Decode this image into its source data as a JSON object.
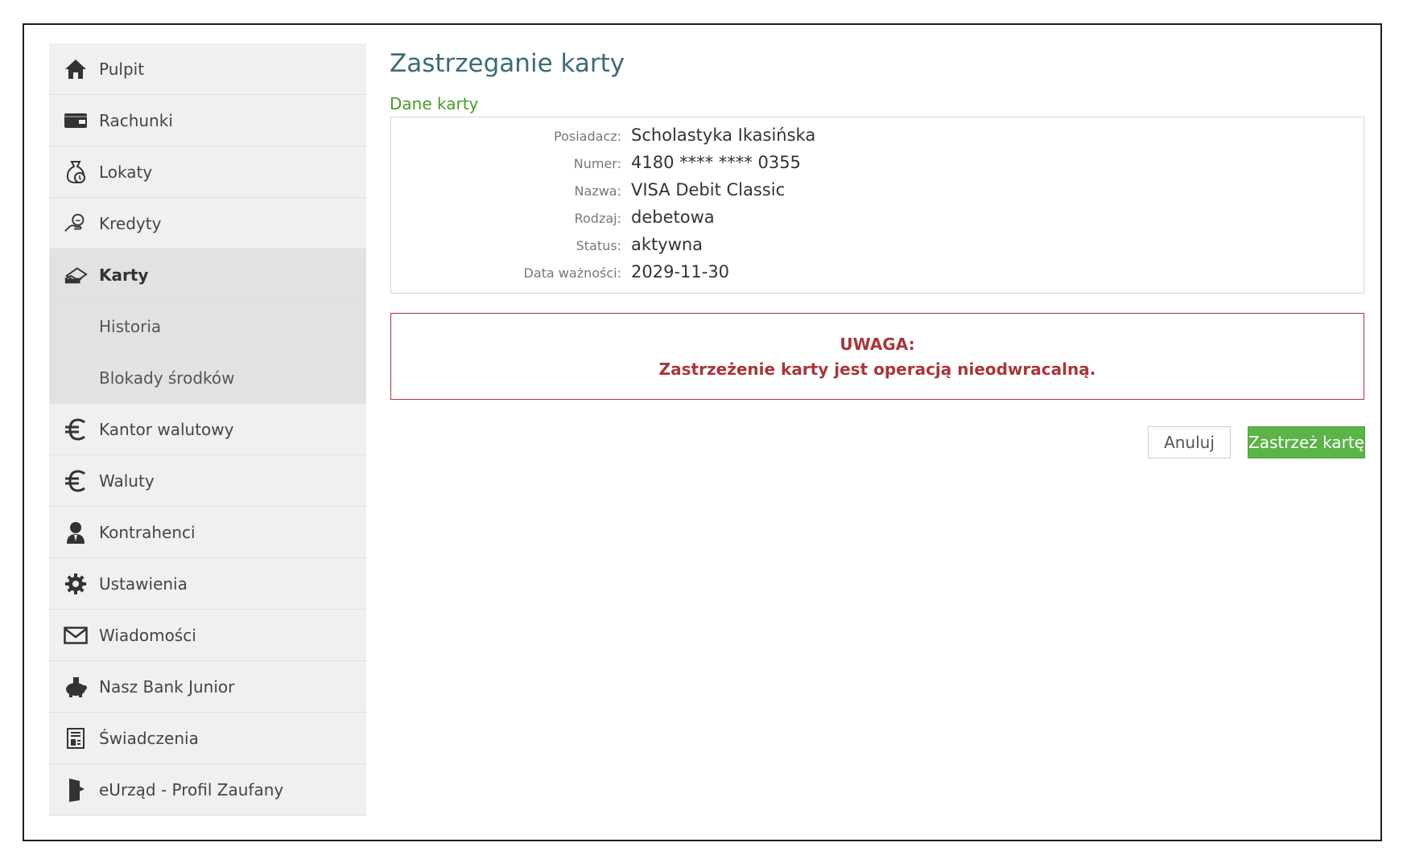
{
  "sidebar": {
    "items": [
      {
        "label": "Pulpit",
        "icon": "home-icon"
      },
      {
        "label": "Rachunki",
        "icon": "wallet-icon"
      },
      {
        "label": "Lokaty",
        "icon": "moneybag-icon"
      },
      {
        "label": "Kredyty",
        "icon": "hand-coin-icon"
      },
      {
        "label": "Karty",
        "icon": "hand-card-icon"
      },
      {
        "label": "Kantor walutowy",
        "icon": "euro-icon"
      },
      {
        "label": "Waluty",
        "icon": "euro-icon"
      },
      {
        "label": "Kontrahenci",
        "icon": "person-icon"
      },
      {
        "label": "Ustawienia",
        "icon": "gear-icon"
      },
      {
        "label": "Wiadomości",
        "icon": "envelope-icon"
      },
      {
        "label": "Nasz Bank Junior",
        "icon": "piggy-bank-icon"
      },
      {
        "label": "Świadczenia",
        "icon": "document-icon"
      },
      {
        "label": "eUrząd - Profil Zaufany",
        "icon": "door-icon"
      }
    ],
    "active_index": 4,
    "subitems": [
      {
        "label": "Historia"
      },
      {
        "label": "Blokady środków"
      }
    ]
  },
  "main": {
    "title": "Zastrzeganie karty",
    "section_title": "Dane karty",
    "card": {
      "rows": [
        {
          "key": "Posiadacz:",
          "value": "Scholastyka Ikasińska"
        },
        {
          "key": "Numer:",
          "value": "4180 **** **** 0355"
        },
        {
          "key": "Nazwa:",
          "value": "VISA Debit Classic"
        },
        {
          "key": "Rodzaj:",
          "value": "debetowa"
        },
        {
          "key": "Status:",
          "value": "aktywna"
        },
        {
          "key": "Data ważności:",
          "value": "2029-11-30"
        }
      ]
    },
    "warning": {
      "title": "UWAGA:",
      "text": "Zastrzeżenie karty jest operacją nieodwracalną."
    },
    "buttons": {
      "cancel_label": "Anuluj",
      "confirm_label": "Zastrzeż kartę"
    }
  },
  "colors": {
    "title": "#3d6b74",
    "section": "#4a9a2a",
    "warning": "#a8363a",
    "confirm_button": "#5cb347",
    "sidebar_bg": "#f0f0f0",
    "sidebar_active_bg": "#e2e2e2"
  }
}
